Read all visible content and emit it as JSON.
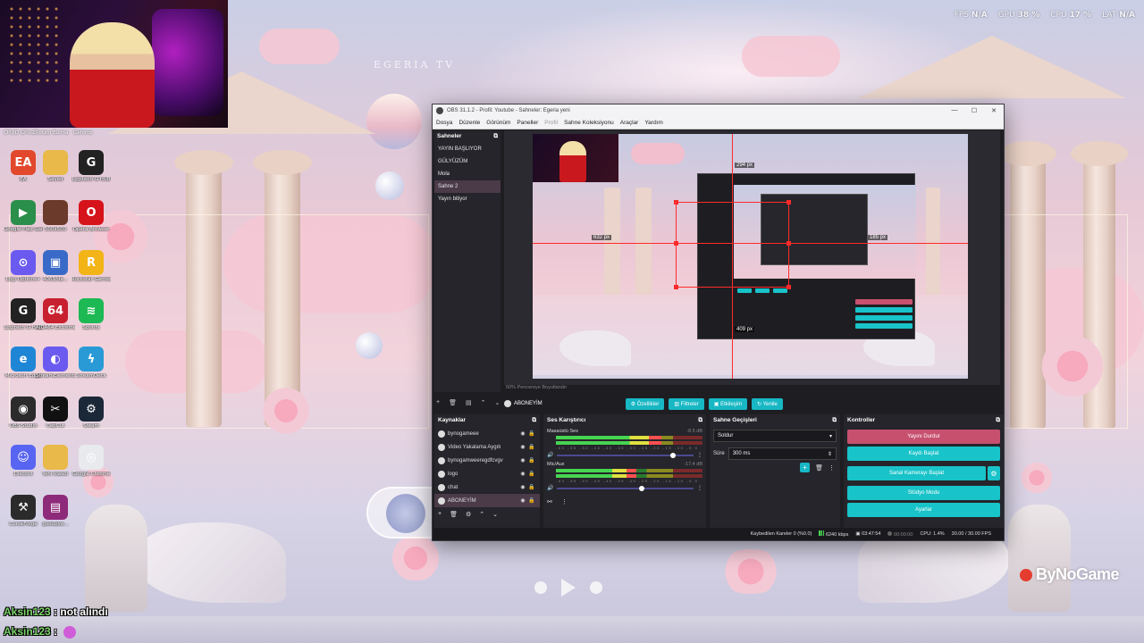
{
  "stats": {
    "fps_label": "FPS",
    "fps_value": "N/A",
    "gpu_label": "GPU",
    "gpu_value": "38 %",
    "cpu_label": "CPU",
    "cpu_value": "17 %",
    "lat_label": "LAT",
    "lat_value": "N/A"
  },
  "wallpaper_watermark": "EGERIA TV",
  "desktop": {
    "top_labels": [
      "CPUID GPU-Z",
      "Rotayı Bulma",
      "Geforce"
    ],
    "icons": [
      {
        "name": "EA",
        "label": "EA",
        "glyph": "EA",
        "color": "#e2482c"
      },
      {
        "name": "Saved",
        "label": "Saved",
        "glyph": "",
        "color": "#e9b949"
      },
      {
        "name": "Logitech G Hub",
        "label": "Logitech G HUB",
        "glyph": "G",
        "color": "#222222"
      },
      {
        "name": "Google Play Games Beta",
        "label": "Google Play Games Beta",
        "glyph": "▶",
        "color": "#2a8f4a"
      },
      {
        "name": "Avatar",
        "label": "500x500",
        "glyph": "",
        "color": "#6b3a2a"
      },
      {
        "name": "Opera GX",
        "label": "Opera Browser",
        "glyph": "O",
        "color": "#d6131b"
      },
      {
        "name": "Logi Options",
        "label": "Logi Options+",
        "glyph": "⊙",
        "color": "#6a5af0"
      },
      {
        "name": "Image",
        "label": "4061fde...",
        "glyph": "▣",
        "color": "#3a6ac8"
      },
      {
        "name": "Rockstar Games",
        "label": "Rockstar Games",
        "glyph": "R",
        "color": "#f2b417"
      },
      {
        "name": "Logitech G Hub 2",
        "label": "Logitech G HUB",
        "glyph": "G",
        "color": "#222222"
      },
      {
        "name": "AIDA64",
        "label": "AIDA64 Extreme",
        "glyph": "64",
        "color": "#c8202f"
      },
      {
        "name": "Spotify",
        "label": "Spotify",
        "glyph": "≋",
        "color": "#1db954"
      },
      {
        "name": "Microsoft Edge",
        "label": "Microsoft Edge",
        "glyph": "e",
        "color": "#1f86d6"
      },
      {
        "name": "StreamElements",
        "label": "StreamElements",
        "glyph": "◐",
        "color": "#6a5af0"
      },
      {
        "name": "Tool",
        "label": "StreamDeck",
        "glyph": "ϟ",
        "color": "#2a9ad6"
      },
      {
        "name": "OBS Studio",
        "label": "OBS Studio",
        "glyph": "◉",
        "color": "#2b2b2b"
      },
      {
        "name": "CapCut",
        "label": "CapCut",
        "glyph": "✂",
        "color": "#111111"
      },
      {
        "name": "Steam",
        "label": "Steam",
        "glyph": "⚙",
        "color": "#1b2838"
      },
      {
        "name": "Discord",
        "label": "Discord",
        "glyph": "☺",
        "color": "#5865f2"
      },
      {
        "name": "Folder",
        "label": "Yeni klasör",
        "glyph": "",
        "color": "#e9b949"
      },
      {
        "name": "Google Chrome",
        "label": "Google Chrome",
        "glyph": "◎",
        "color": "#e8eaed"
      },
      {
        "name": "CurseForge",
        "label": "CurseForge",
        "glyph": "⚒",
        "color": "#2b2b2b"
      },
      {
        "name": "WinRAR",
        "label": "goodbye...",
        "glyph": "▤",
        "color": "#8e2a7a"
      }
    ]
  },
  "chat": [
    {
      "user": "Aksin123",
      "message": ": not alındı"
    },
    {
      "user": "Aksin123",
      "message": ":"
    }
  ],
  "obs": {
    "title": "OBS 31.1.2 - Profil: Youtube - Sahneler: Egeria yeni",
    "menu": [
      "Dosya",
      "Düzenle",
      "Görünüm",
      "Paneller",
      "Profil",
      "Sahne Koleksiyonu",
      "Araçlar",
      "Yardım"
    ],
    "scenes_title": "Sahneler",
    "scenes": [
      "YAYIN BAŞLIYOR",
      "GÜLYÜZÜM",
      "Mola",
      "Sahne 2",
      "Yayın bitiyor"
    ],
    "active_scene_index": 3,
    "preview_dims": {
      "top": "294 px",
      "left": "632 px",
      "right": "185 px",
      "bottom": "409 px"
    },
    "preview_bottom": "50%   Pencereye Boyutlandır",
    "source_toolbar": {
      "selected": "ABONEYİM",
      "buttons": [
        "Özellikler",
        "Filtreler",
        "Etkileşim",
        "Yenile"
      ]
    },
    "sources_title": "Kaynaklar",
    "sources": [
      "bynogameee",
      "Video Yakalama Aygıtı",
      "bynogamweeregdfcvgv",
      "logo",
      "chat",
      "ABONEYİM"
    ],
    "active_source_index": 5,
    "mixer_title": "Ses Karıştırıcı",
    "mixer": [
      {
        "name": "Masaüstü Ses",
        "db": "-8.5 dB",
        "level": 0.72,
        "volume": 0.85
      },
      {
        "name": "Mic/Aux",
        "db": "-17.4 dB",
        "level": 0.55,
        "volume": 0.62
      }
    ],
    "meter_ticks": "-60 -55 -50 -45 -40 -35 -30 -25 -20 -15 -10 -5 0",
    "transitions_title": "Sahne Geçişleri",
    "transition": "Soldur",
    "duration_label": "Süre",
    "duration_value": "300 ms",
    "controls_title": "Kontroller",
    "controls": [
      "Yayını Durdur",
      "Kaydı Başlat",
      "Sanal Kamerayı Başlat",
      "Stüdyo Modu",
      "Ayarlar"
    ],
    "status": {
      "dropped": "Kaybedilen Kareler 0 (%0.0)",
      "bitrate": "6240 kbps",
      "stream_time": "03:47:54",
      "rec_time": "00:00:00",
      "cpu": "CPU: 1.4%",
      "fps": "30.00 / 30.00 FPS"
    }
  },
  "brand_watermark": "ByNoGame"
}
